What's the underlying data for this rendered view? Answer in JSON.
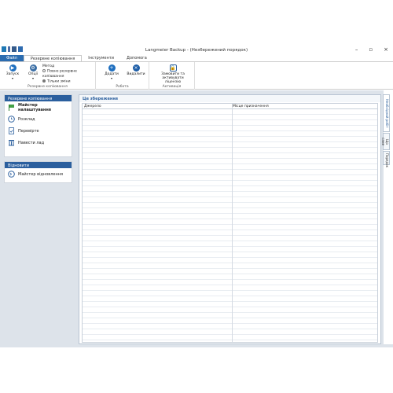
{
  "window": {
    "title": "Langmeier Backup - (Незбережений порядок)",
    "buttons": [
      "–",
      "▫",
      "×"
    ]
  },
  "tabs": [
    {
      "label": "Файл"
    },
    {
      "label": "Резервне копіювання"
    },
    {
      "label": "Інструменти"
    },
    {
      "label": "Допомога"
    }
  ],
  "ribbon": {
    "start_label": "Запуск",
    "options_label": "Опції",
    "method_label": "Метод",
    "full_backup_label": "Повне резервне копіювання",
    "only_changes_label": "Тільки зміни",
    "group_backup_label": "Резервне копіювання",
    "add_label": "Додати",
    "delete_label": "Видалити",
    "group_jobs_label": "Робота",
    "license_label": "Замовити та активувати ліцензію",
    "group_activation_label": "Активація"
  },
  "sidebar": {
    "backup_header": "Резервне копіювання",
    "items": [
      {
        "label": "Майстер налаштування"
      },
      {
        "label": "Розклад"
      },
      {
        "label": "Перевірте"
      },
      {
        "label": "Навести лад"
      }
    ],
    "restore_header": "Відновити",
    "restore_items": [
      {
        "label": "Майстер відновлення"
      }
    ]
  },
  "main": {
    "title": "Це збереження",
    "columns": [
      "Джерело",
      "Місце призначення"
    ]
  },
  "side_tabs": [
    "Необхідний робіт",
    "Що саме",
    "Порядок"
  ],
  "colors": {
    "accent": "#2b5f9e",
    "file_tab": "#2b6cb0",
    "panel_bg": "#dde3ea"
  }
}
